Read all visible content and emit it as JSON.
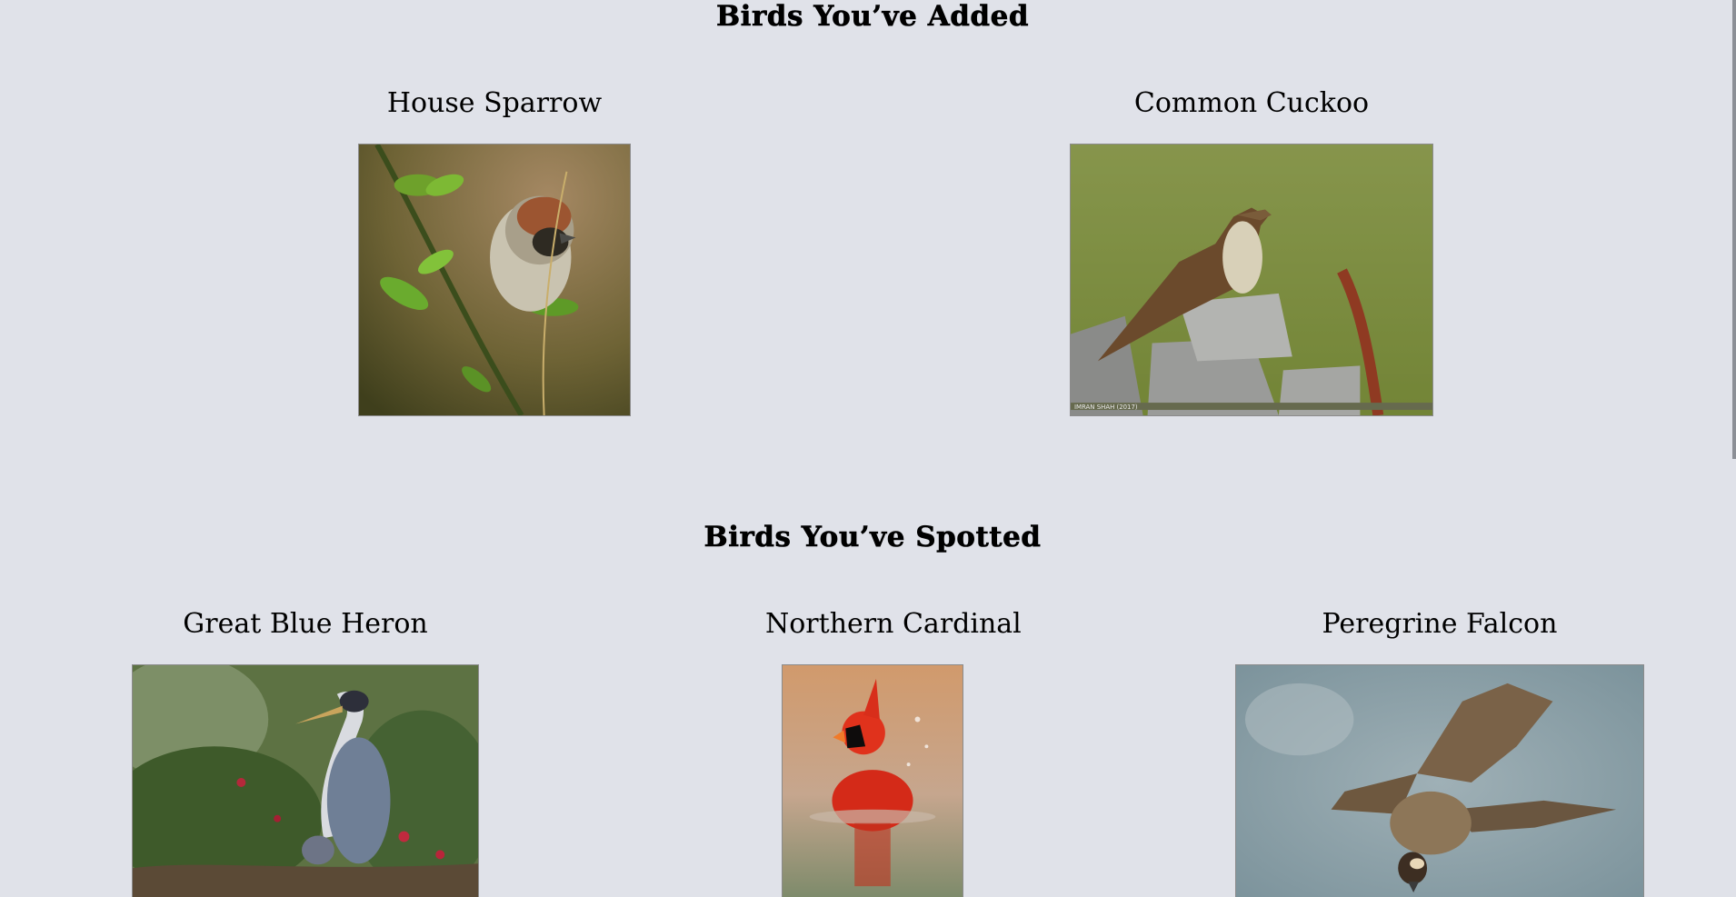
{
  "sections": {
    "added": {
      "title": "Birds You’ve Added",
      "birds": [
        {
          "name": "House Sparrow",
          "image_icon": "house-sparrow-photo"
        },
        {
          "name": "Common Cuckoo",
          "image_icon": "common-cuckoo-photo",
          "photo_caption": "IMRAN SHAH (2017)"
        }
      ]
    },
    "spotted": {
      "title": "Birds You’ve Spotted",
      "birds": [
        {
          "name": "Great Blue Heron",
          "image_icon": "great-blue-heron-photo"
        },
        {
          "name": "Northern Cardinal",
          "image_icon": "northern-cardinal-photo"
        },
        {
          "name": "Peregrine Falcon",
          "image_icon": "peregrine-falcon-photo"
        }
      ]
    }
  },
  "colors": {
    "background": "#e0e2e9",
    "text": "#000000"
  }
}
